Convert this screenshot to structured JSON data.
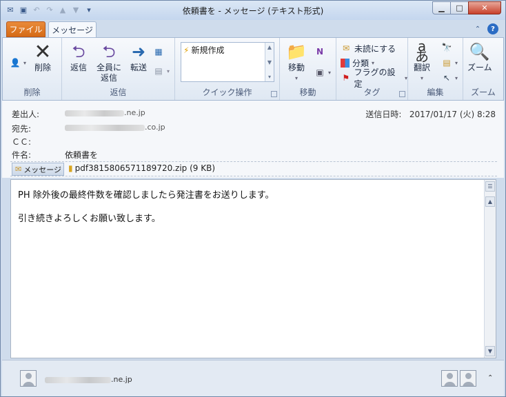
{
  "window": {
    "title": "依頼書を - メッセージ (テキスト形式)",
    "qat_icons": [
      "mail-icon",
      "save-icon",
      "undo-icon",
      "redo-icon",
      "up-icon",
      "down-icon",
      "customize-icon"
    ]
  },
  "tabs": {
    "file": "ファイル",
    "message": "メッセージ"
  },
  "ribbon": {
    "delete": {
      "label": "削除",
      "group": "削除"
    },
    "respond": {
      "reply": "返信",
      "reply_all_1": "全員に",
      "reply_all_2": "返信",
      "forward": "転送",
      "group": "返信"
    },
    "quick": {
      "item": "新規作成",
      "group": "クイック操作"
    },
    "move": {
      "label": "移動",
      "group": "移動"
    },
    "tags": {
      "unread": "未読にする",
      "categorize": "分類",
      "followup": "フラグの設定",
      "group": "タグ"
    },
    "edit": {
      "translate": "翻訳",
      "group": "編集"
    },
    "zoom": {
      "label": "ズーム",
      "group": "ズーム"
    }
  },
  "header": {
    "from_label": "差出人:",
    "from_value": ".ne.jp",
    "to_label": "宛先:",
    "to_value": ".co.jp",
    "cc_label": "ＣＣ:",
    "subject_label": "件名:",
    "subject_value": "依頼書を",
    "sent_label": "送信日時:",
    "sent_value": "2017/01/17 (火) 8:28"
  },
  "attachments": {
    "message_tab": "メッセージ",
    "file": "pdf3815806571189720.zip (9 KB)"
  },
  "body": {
    "line1": "PH 除外後の最終件数を確認しましたら発注書をお送りします。",
    "line2": "引き続きよろしくお願い致します。"
  },
  "people_pane": {
    "sender": ".ne.jp"
  }
}
